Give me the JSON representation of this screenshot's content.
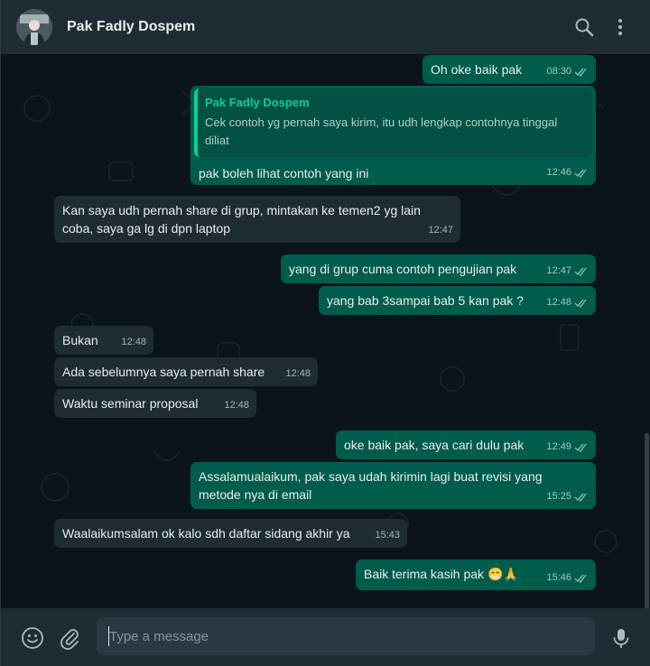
{
  "header": {
    "contact_name": "Pak Fadly Dospem"
  },
  "composer": {
    "placeholder": "Type a message"
  },
  "messages": [
    {
      "dir": "out",
      "text": "Oh oke baik pak",
      "time": "08:30",
      "read": true
    },
    {
      "dir": "out",
      "quote_author": "Pak Fadly Dospem",
      "quote_text": "Cek contoh yg pernah saya kirim,  itu udh lengkap contohnya tinggal diliat",
      "text": "pak boleh lihat contoh yang ini",
      "time": "12:46",
      "read": true
    },
    {
      "dir": "in",
      "text": "Kan saya udh pernah share di grup, mintakan ke temen2 yg lain coba, saya ga lg di dpn laptop",
      "time": "12:47"
    },
    {
      "dir": "out",
      "text": "yang di grup cuma contoh pengujian pak",
      "time": "12:47",
      "read": true
    },
    {
      "dir": "out",
      "text": "yang bab 3sampai bab 5 kan pak ?",
      "time": "12:48",
      "read": true
    },
    {
      "dir": "in",
      "text": "Bukan",
      "time": "12:48"
    },
    {
      "dir": "in",
      "text": "Ada sebelumnya saya pernah share",
      "time": "12:48"
    },
    {
      "dir": "in",
      "text": "Waktu seminar proposal",
      "time": "12:48"
    },
    {
      "dir": "out",
      "text": "oke baik pak, saya cari dulu pak",
      "time": "12:49",
      "read": true
    },
    {
      "dir": "out",
      "text": "Assalamualaikum, pak saya udah kirimin lagi buat revisi yang metode nya di email",
      "time": "15:25",
      "read": true
    },
    {
      "dir": "in",
      "text": "Waalaikumsalam ok kalo sdh daftar sidang akhir ya",
      "time": "15:43"
    },
    {
      "dir": "out",
      "text": "Baik terima kasih pak 😁🙏",
      "time": "15:46",
      "read": true
    }
  ],
  "colors": {
    "header_bg": "#202c33",
    "chat_bg": "#0b141a",
    "incoming_bubble": "#202c33",
    "outgoing_bubble": "#005c4b",
    "accent": "#06cf9c",
    "read_ticks": "#a3c9be"
  },
  "icons": {
    "search": "search-icon",
    "menu": "kebab-menu-icon",
    "emoji": "emoji-icon",
    "attach": "paperclip-icon",
    "mic": "microphone-icon"
  }
}
